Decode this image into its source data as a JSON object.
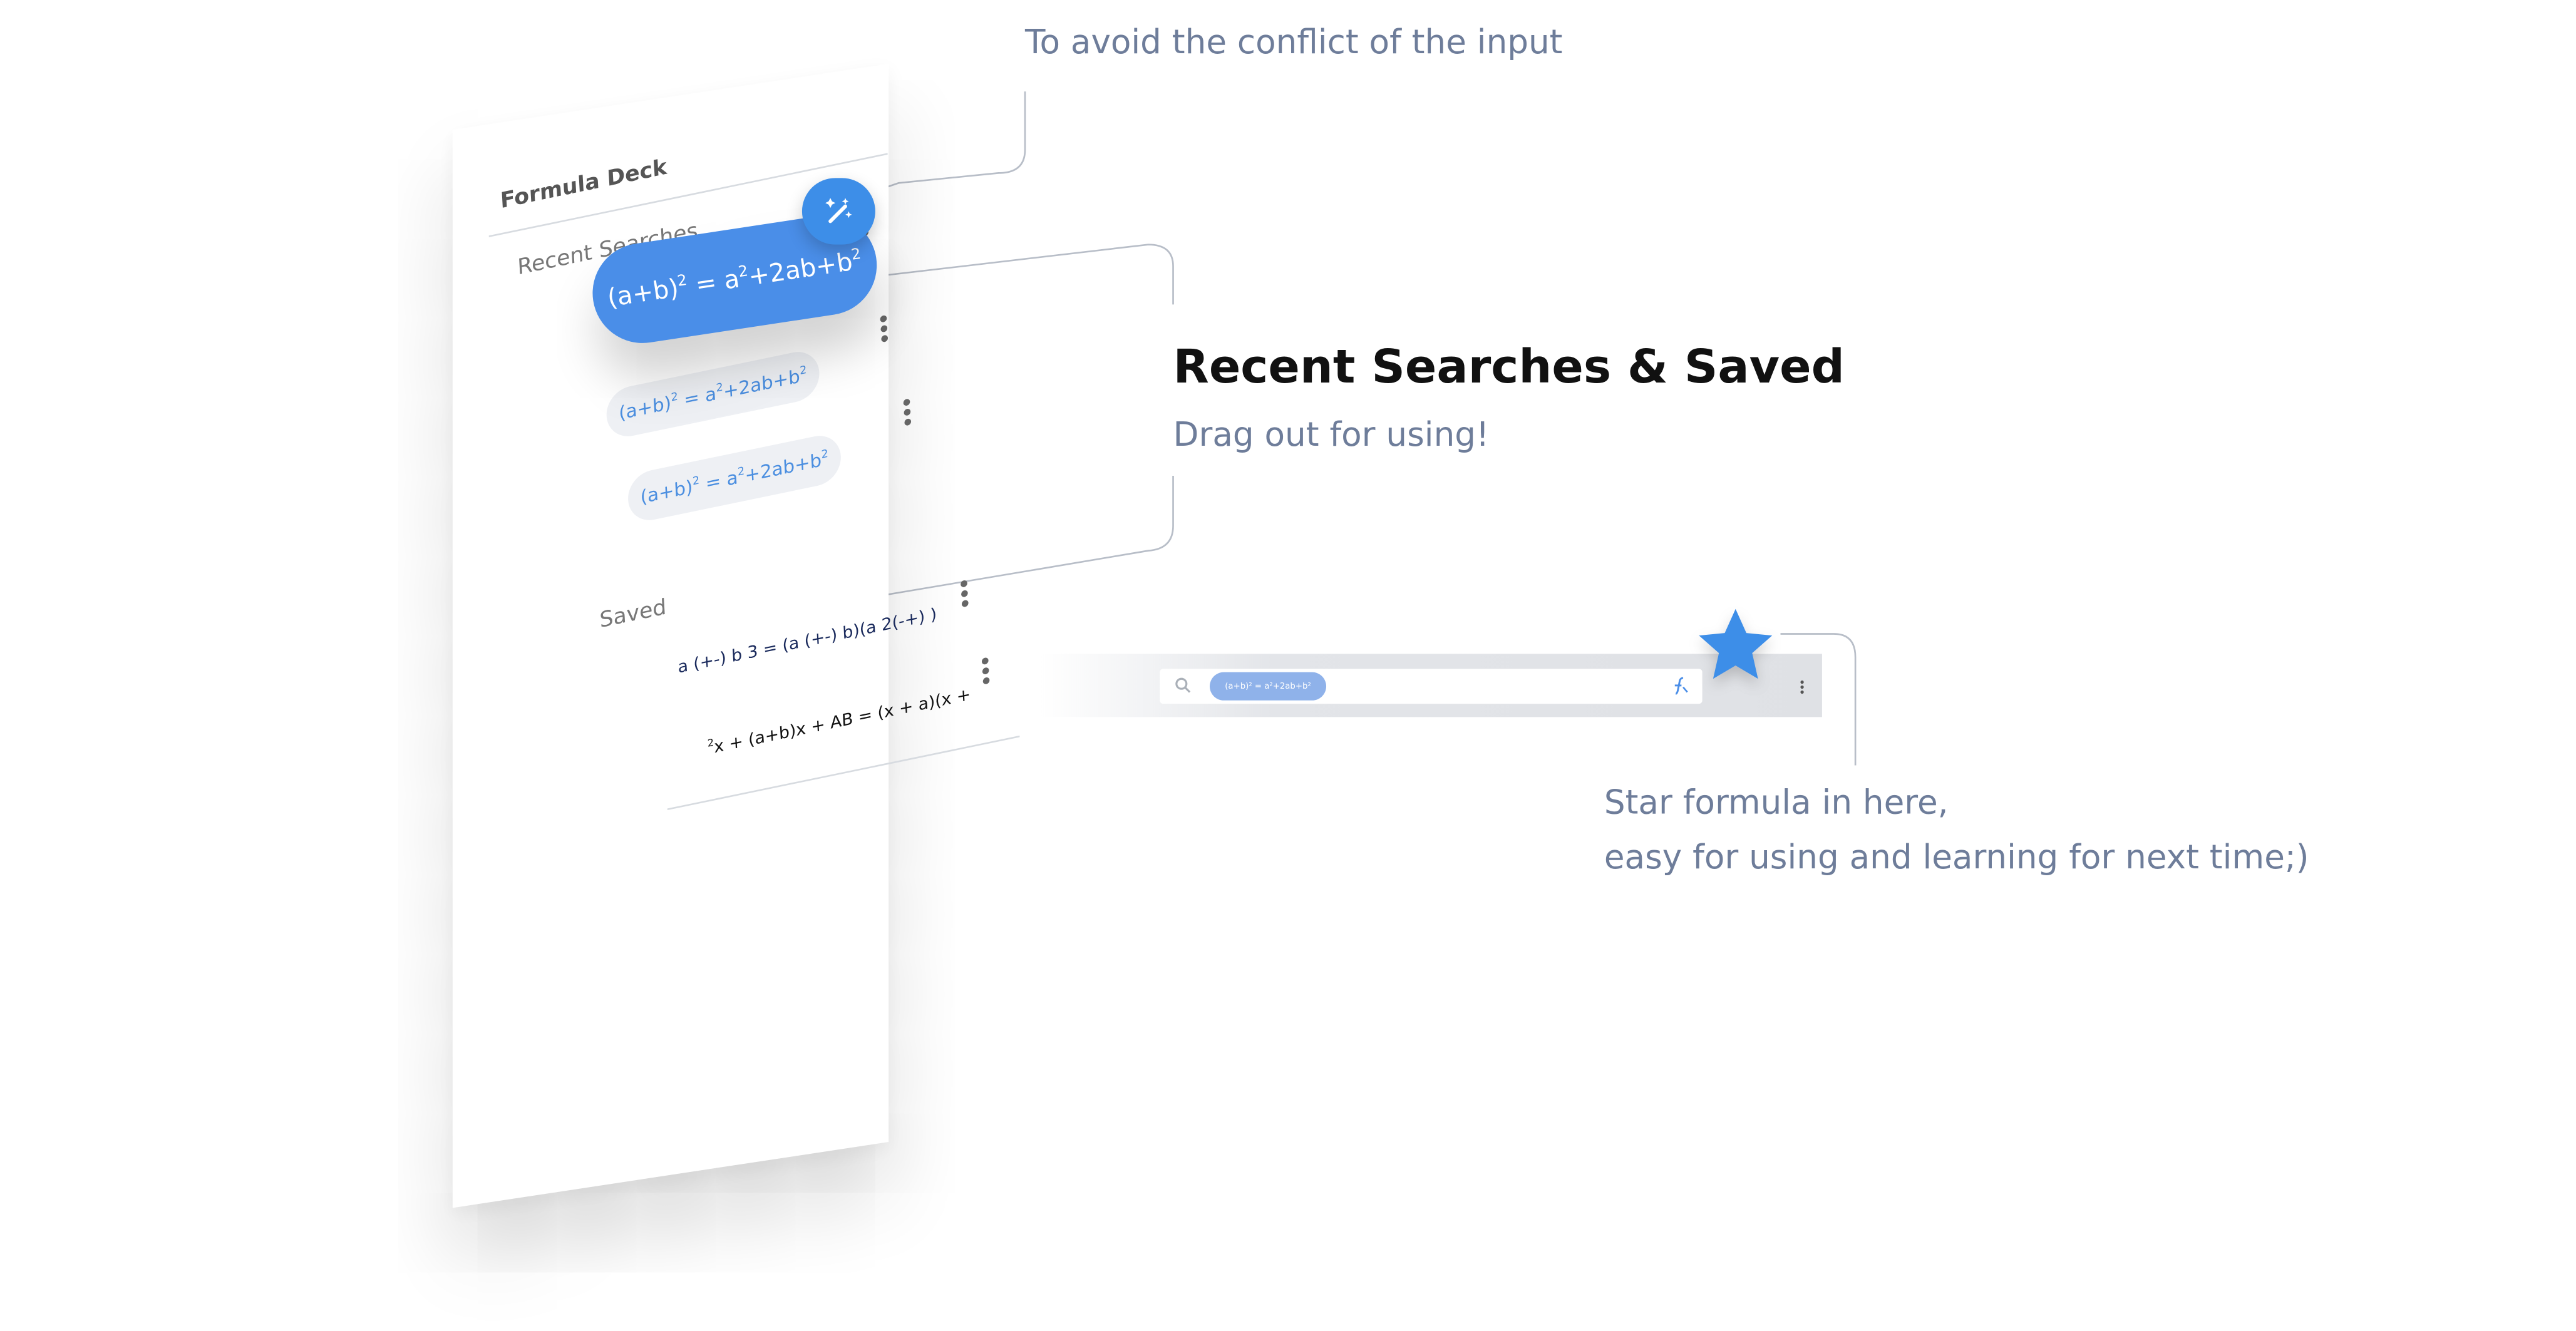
{
  "annotations": {
    "input_conflict": "To avoid the conflict of the input",
    "section_title": "Recent  Searches & Saved",
    "section_subtitle": "Drag out for using!",
    "star_line1": "Star formula in here,",
    "star_line2": "easy for using and learning for next time;)"
  },
  "panel": {
    "title": "Formula Deck",
    "recent_label": "Recent Searches",
    "saved_label": "Saved",
    "recent_items": [
      {
        "base": "(a+b)",
        "exp1": "2",
        "mid": " = a",
        "exp2": "2",
        "rest": "+2ab+b",
        "exp3": "2"
      },
      {
        "base": "(a+b)",
        "exp1": "2",
        "mid": " = a",
        "exp2": "2",
        "rest": "+2ab+b",
        "exp3": "2"
      },
      {
        "base": "(a+b)",
        "exp1": "2",
        "mid": " = a",
        "exp2": "2",
        "rest": "+2ab+b",
        "exp3": "2"
      }
    ],
    "saved_items": [
      {
        "text": "a   (+-) b 3 = (a (+-) b)(a 2(-+) )"
      },
      {
        "sup": "2",
        "text": "x   + (a+b)x + AB = (x + a)(x +"
      }
    ]
  },
  "searchbar": {
    "chip_text": "(a+b)² = a²+2ab+b²"
  },
  "colors": {
    "accent": "#4a8ee8",
    "annotation": "#6e7d9a",
    "star": "#3d8ee8"
  },
  "icons": [
    "magic-wand-icon",
    "more-vert-icon",
    "search-icon",
    "formula-icon",
    "star-icon"
  ]
}
